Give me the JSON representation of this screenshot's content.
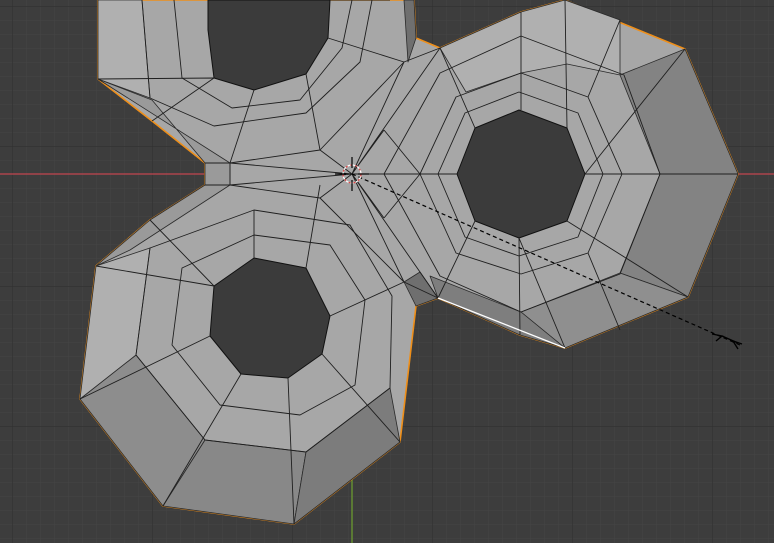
{
  "viewport": {
    "type": "3d-viewport",
    "mode": "edit-mode",
    "background_color": "#3d3d3d",
    "grid_minor_color": "#444444",
    "grid_major_color": "#303030",
    "x_axis_color": "#c1454f",
    "y_axis_color": "#6a9a2f"
  },
  "mesh": {
    "object": "gear-mesh-with-three-holes",
    "face_color": "#a7a7a7",
    "face_light_color": "#b1b1b1",
    "face_dark_color": "#828282",
    "edge_color": "#2a2a2a",
    "selected_outline_color": "#ee8f1a",
    "selected_edge_color": "#ffffff"
  },
  "cursor": {
    "icon": "3d-cursor-icon"
  },
  "transform": {
    "operator": "scale",
    "icon": "scale-arrow-icon",
    "line_style": "dashed"
  }
}
